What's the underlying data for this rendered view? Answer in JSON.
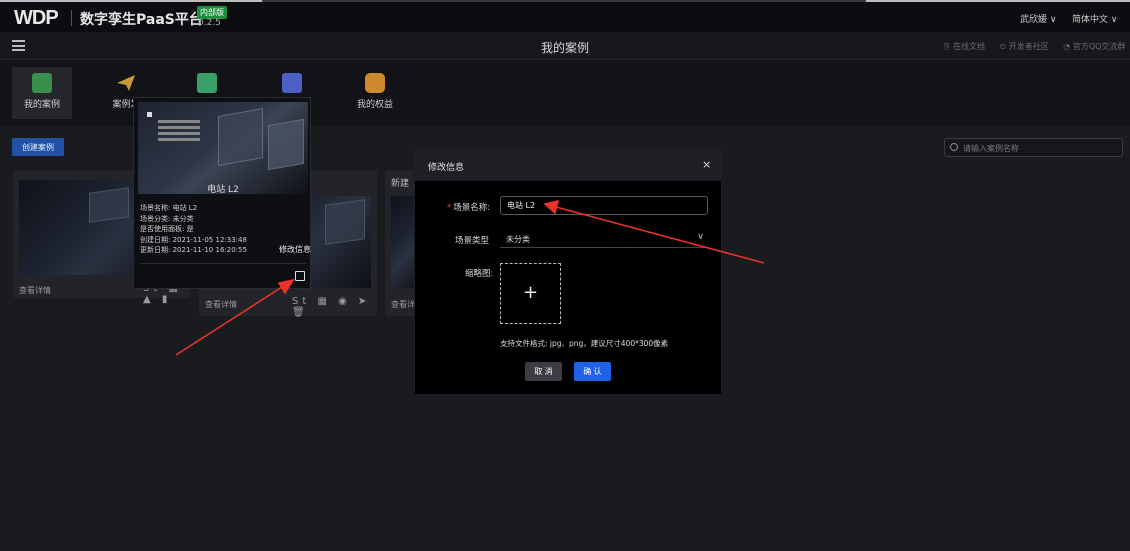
{
  "topbar": {
    "logo": "WDP",
    "product": "数字孪生PaaS平台",
    "badge": "内部版",
    "version": "0.2.5",
    "user": "武欣媛",
    "language": "简体中文"
  },
  "subbar": {
    "title": "我的案例",
    "links": [
      "在线文档",
      "开发者社区",
      "官方QQ交流群"
    ]
  },
  "tools": [
    {
      "label": "我的案例",
      "active": true,
      "color": "#3b8f4c"
    },
    {
      "label": "案例发",
      "active": false,
      "color": "#c89a3a"
    },
    {
      "label": "",
      "active": false,
      "color": "#3aa06a"
    },
    {
      "label": "",
      "active": false,
      "color": "#4b5fc4"
    },
    {
      "label": "我的权益",
      "active": false,
      "color": "#d08a2e"
    }
  ],
  "create_button": "创建案例",
  "search_placeholder": "请输入案例名称",
  "cards": [
    {
      "footer": "查看详情",
      "actions": "St ▦ ▲ ▮"
    },
    {
      "footer": "查看详情",
      "actions": "St ▦ ◉ ➤ 🗑"
    },
    {
      "title": "新建",
      "footer": "查看详情",
      "actions": "St"
    }
  ],
  "popover": {
    "name": "电站 L2",
    "info": [
      "场景名称: 电站 L2",
      "场景分类: 未分类",
      "是否使用面板: 是",
      "创建日期: 2021-11-05 12:33:48",
      "更新日期: 2021-11-10 16:20:55"
    ],
    "edit_label": "修改信息"
  },
  "modal": {
    "title": "修改信息",
    "close": "×",
    "name_label": "场景名称:",
    "name_value": "电站 L2",
    "type_label": "场景类型",
    "type_value": "未分类",
    "thumb_label": "缩略图:",
    "upload_symbol": "+",
    "hint": "支持文件格式: jpg、png，建议尺寸400*300像素",
    "cancel": "取 消",
    "ok": "确 认"
  },
  "arrow_color": "#e8322a"
}
